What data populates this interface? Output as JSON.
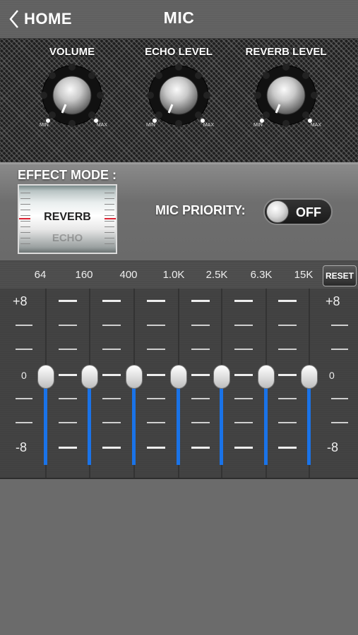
{
  "header": {
    "back_label": "HOME",
    "title": "MIC"
  },
  "knobs": [
    {
      "label": "VOLUME",
      "min": "MIN",
      "max": "MAX"
    },
    {
      "label": "ECHO LEVEL",
      "min": "MIN",
      "max": "MAX"
    },
    {
      "label": "REVERB LEVEL",
      "min": "MIN",
      "max": "MAX"
    }
  ],
  "effect": {
    "title": "EFFECT MODE :",
    "current": "REVERB",
    "next": "ECHO"
  },
  "mic_priority": {
    "label": "MIC PRIORITY:",
    "state": "OFF"
  },
  "eq": {
    "bands": [
      "64",
      "160",
      "400",
      "1.0K",
      "2.5K",
      "6.3K",
      "15K"
    ],
    "reset_label": "RESET",
    "scale": {
      "top": "+8",
      "mid": "0",
      "bottom": "-8"
    },
    "gains": [
      0,
      0,
      0,
      0,
      0,
      0,
      0
    ]
  },
  "colors": {
    "accent": "#1a73e8"
  }
}
